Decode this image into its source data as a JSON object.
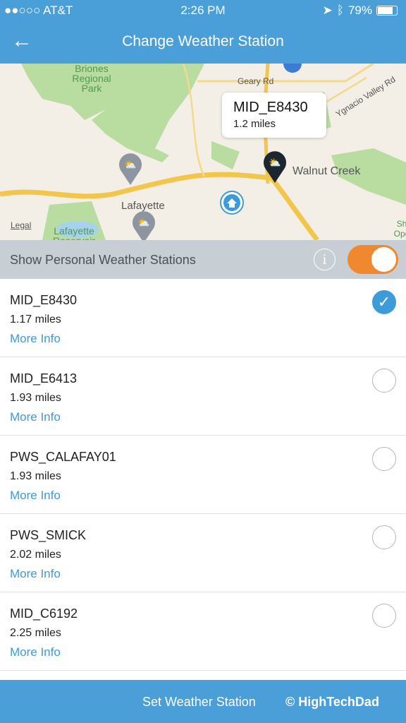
{
  "status": {
    "carrier": "●●○○○ AT&T",
    "time": "2:26 PM",
    "battery": "79%",
    "battery_level": 0.79
  },
  "nav": {
    "title": "Change Weather Station",
    "back_icon": "arrow-left-icon"
  },
  "map": {
    "labels": {
      "briones": "Briones Regional Park",
      "geary": "Geary Rd",
      "ygnacio": "Ygnacio Valley Rd",
      "walnut": "Walnut Creek",
      "lafayette": "Lafayette",
      "reservoir": "Lafayette Reservoir",
      "legal": "Legal",
      "sh": "Sh Ope"
    },
    "callout": {
      "name": "MID_E8430",
      "distance": "1.2 miles"
    }
  },
  "pws": {
    "label": "Show Personal Weather Stations",
    "info": "i",
    "enabled": true
  },
  "stations": [
    {
      "name": "MID_E8430",
      "distance": "1.17 miles",
      "more": "More Info",
      "selected": true
    },
    {
      "name": "MID_E6413",
      "distance": "1.93 miles",
      "more": "More Info",
      "selected": false
    },
    {
      "name": "PWS_CALAFAY01",
      "distance": "1.93 miles",
      "more": "More Info",
      "selected": false
    },
    {
      "name": "PWS_SMICK",
      "distance": "2.02 miles",
      "more": "More Info",
      "selected": false
    },
    {
      "name": "MID_C6192",
      "distance": "2.25 miles",
      "more": "More Info",
      "selected": false
    }
  ],
  "footer": {
    "button": "Set Weather Station",
    "watermark": "© HighTechDad"
  },
  "colors": {
    "primary": "#4a9fd9",
    "accent": "#f0882f",
    "link": "#3d9bd8"
  }
}
